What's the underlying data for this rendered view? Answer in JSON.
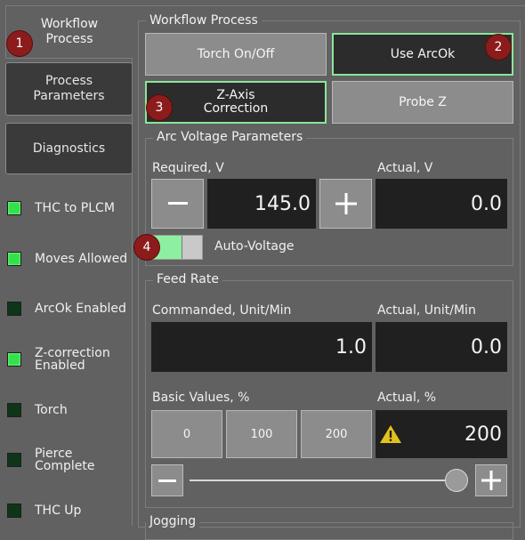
{
  "tabs": [
    {
      "label_line1": "Workflow",
      "label_line2": "Process"
    },
    {
      "label_line1": "Process",
      "label_line2": "Parameters"
    },
    {
      "label_line1": "Diagnostics",
      "label_line2": ""
    }
  ],
  "indicators": [
    {
      "label_line1": "THC to PLCM",
      "label_line2": "",
      "state": "on"
    },
    {
      "label_line1": "Moves Allowed",
      "label_line2": "",
      "state": "on"
    },
    {
      "label_line1": "ArcOk Enabled",
      "label_line2": "",
      "state": "off"
    },
    {
      "label_line1": "Z-correction",
      "label_line2": "Enabled",
      "state": "on"
    },
    {
      "label_line1": "Torch",
      "label_line2": "",
      "state": "off"
    },
    {
      "label_line1": "Pierce",
      "label_line2": "Complete",
      "state": "off"
    },
    {
      "label_line1": "THC Up",
      "label_line2": "",
      "state": "off"
    }
  ],
  "workflow": {
    "title": "Workflow Process",
    "torch_button": "Torch On/Off",
    "arcok_button": "Use ArcOk",
    "zaxis_line1": "Z-Axis",
    "zaxis_line2": "Correction",
    "probe_button": "Probe Z"
  },
  "arc_voltage": {
    "title": "Arc Voltage Parameters",
    "required_label": "Required, V",
    "actual_label": "Actual, V",
    "required_value": "145.0",
    "actual_value": "0.0",
    "auto_voltage_label": "Auto-Voltage"
  },
  "feed_rate": {
    "title": "Feed Rate",
    "commanded_label": "Commanded, Unit/Min",
    "actual_label": "Actual, Unit/Min",
    "commanded_value": "1.0",
    "actual_value": "0.0",
    "basic_label": "Basic Values, %",
    "actual_pct_label": "Actual, %",
    "preset_0": "0",
    "preset_100": "100",
    "preset_200": "200",
    "actual_pct_value": "200",
    "slider_level": 1.0
  },
  "jogging": {
    "title": "Jogging"
  },
  "callouts": [
    "1",
    "2",
    "3",
    "4"
  ],
  "colors": {
    "led_on": "#33e24a",
    "led_off": "#0f3518",
    "callout": "#8c1c1c",
    "active_border": "#8be59b"
  }
}
